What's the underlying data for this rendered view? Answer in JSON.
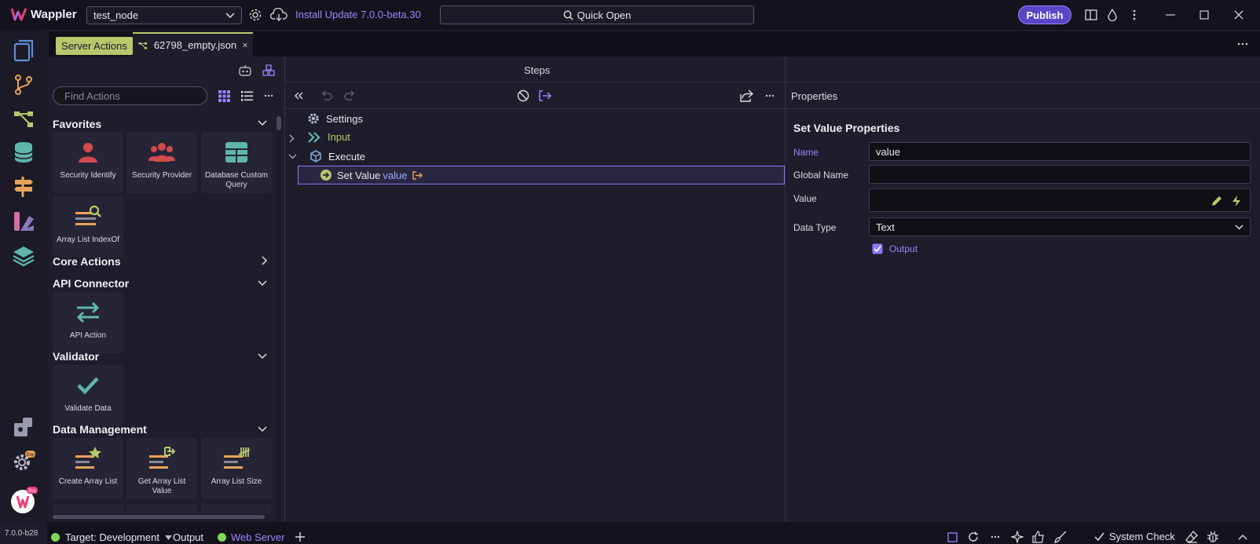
{
  "app": {
    "name": "Wappler",
    "version": "7.0.0-b28"
  },
  "titlebar": {
    "project": "test_node",
    "update_text": "Install Update 7.0.0-beta.30",
    "quick_open": "Quick Open",
    "publish": "Publish"
  },
  "tabs": {
    "server_actions": "Server Actions",
    "file": "62798_empty.json"
  },
  "actions": {
    "search_placeholder": "Find Actions",
    "favorites": {
      "title": "Favorites",
      "items": [
        "Security Identify",
        "Security Provider",
        "Database Custom Query",
        "Array List IndexOf"
      ]
    },
    "core": {
      "title": "Core Actions"
    },
    "api": {
      "title": "API Connector",
      "items": [
        "API Action"
      ]
    },
    "validator": {
      "title": "Validator",
      "items": [
        "Validate Data"
      ]
    },
    "data_mgmt": {
      "title": "Data Management",
      "items": [
        "Create Array List",
        "Get Array List Value",
        "Array List Size"
      ]
    }
  },
  "steps": {
    "title": "Steps",
    "settings": "Settings",
    "input": "Input",
    "execute": "Execute",
    "selected": {
      "label": "Set Value",
      "value": "value"
    }
  },
  "properties": {
    "panel_title": "Properties",
    "heading": "Set Value Properties",
    "name_label": "Name",
    "name_value": "value",
    "global_label": "Global Name",
    "global_value": "",
    "value_label": "Value",
    "value_value": "",
    "type_label": "Data Type",
    "type_value": "Text",
    "output_label": "Output",
    "output_checked": true
  },
  "status": {
    "target": "Target: Development",
    "output": "Output",
    "web_server": "Web Server",
    "system_check": "System Check"
  },
  "colors": {
    "accent": "#9b85ff",
    "publish_bg": "#5b44c6",
    "server_actions_tab": "#b6c86b",
    "status_green": "#7ed957"
  }
}
